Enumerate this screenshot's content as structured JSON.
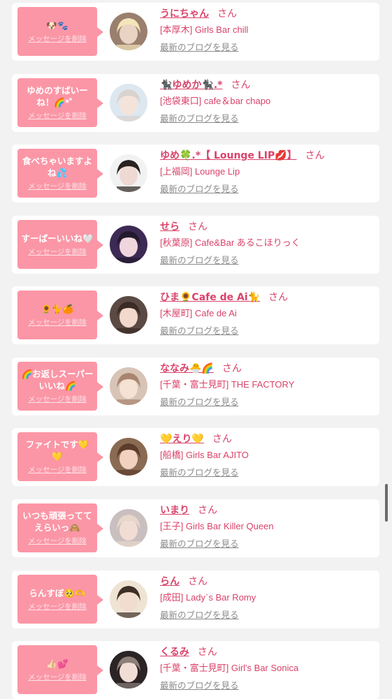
{
  "labels": {
    "delete": "メッセージを削除",
    "latest_blog": "最新のブログを見る",
    "san": "さん"
  },
  "items": [
    {
      "message": "🐶🐾",
      "name": "うにちゃん",
      "shop": "[本厚木] Girls Bar chill",
      "avatar_colors": [
        "#9a7f6e",
        "#e9d3c3",
        "#f3e5b9"
      ]
    },
    {
      "message": "ゆめのすばいーね！🌈*゜",
      "name": "🐈‍⬛ゆめか🐈‍⬛.*",
      "shop": "[池袋東口] cafe＆bar chapo",
      "avatar_colors": [
        "#dde7f0",
        "#f4e3da",
        "#d9d2cf"
      ]
    },
    {
      "message": "食べちゃいますよね💦",
      "name": "ゆめ🍀.*【 Lounge LIP💋】",
      "shop": "[上福岡] Lounge Lip",
      "avatar_colors": [
        "#f2f2f2",
        "#eedad2",
        "#2a2220"
      ]
    },
    {
      "message": "すーぱーいいね🤍",
      "name": "せら",
      "shop": "[秋葉原] Cafe&Bar あるこほりっく",
      "avatar_colors": [
        "#3c2a55",
        "#f0d6dc",
        "#221a2c"
      ]
    },
    {
      "message": "🌻🐈🍊",
      "name": "ひま🌻Cafe de Ai🐈",
      "shop": "[木屋町] Cafe de Ai",
      "avatar_colors": [
        "#5b4a44",
        "#f3d9cc",
        "#3a2b25"
      ]
    },
    {
      "message": "🌈お返しスーパーいいね🌈",
      "name": "ななみ🐣🌈",
      "shop": "[千葉・富士見町] THE FACTORY",
      "avatar_colors": [
        "#d8c4b6",
        "#f5e2d5",
        "#a8856e"
      ]
    },
    {
      "message": "ファイトです💛💛",
      "name": "💛えり💛",
      "shop": "[船橋] Girls Bar AJITO",
      "avatar_colors": [
        "#8a6a52",
        "#f1d2bf",
        "#5c3d2c"
      ]
    },
    {
      "message": "いつも頑張っててえらいっ🙈",
      "name": "いまり",
      "shop": "[王子] Girls Bar Killer Queen",
      "avatar_colors": [
        "#c9bfbf",
        "#f2ddd5",
        "#e7d7c8"
      ]
    },
    {
      "message": "らんすぼ🥺🫶",
      "name": "らん",
      "shop": "[成田] Lady`s Bar Romy",
      "avatar_colors": [
        "#efe4d4",
        "#f2dccf",
        "#3e2f27"
      ]
    },
    {
      "message": "👍🏻💕",
      "name": "くるみ",
      "shop": "[千葉・富士見町] Girl's Bar Sonica",
      "avatar_colors": [
        "#2b2424",
        "#f1dcd6",
        "#8c7f7a"
      ]
    }
  ]
}
